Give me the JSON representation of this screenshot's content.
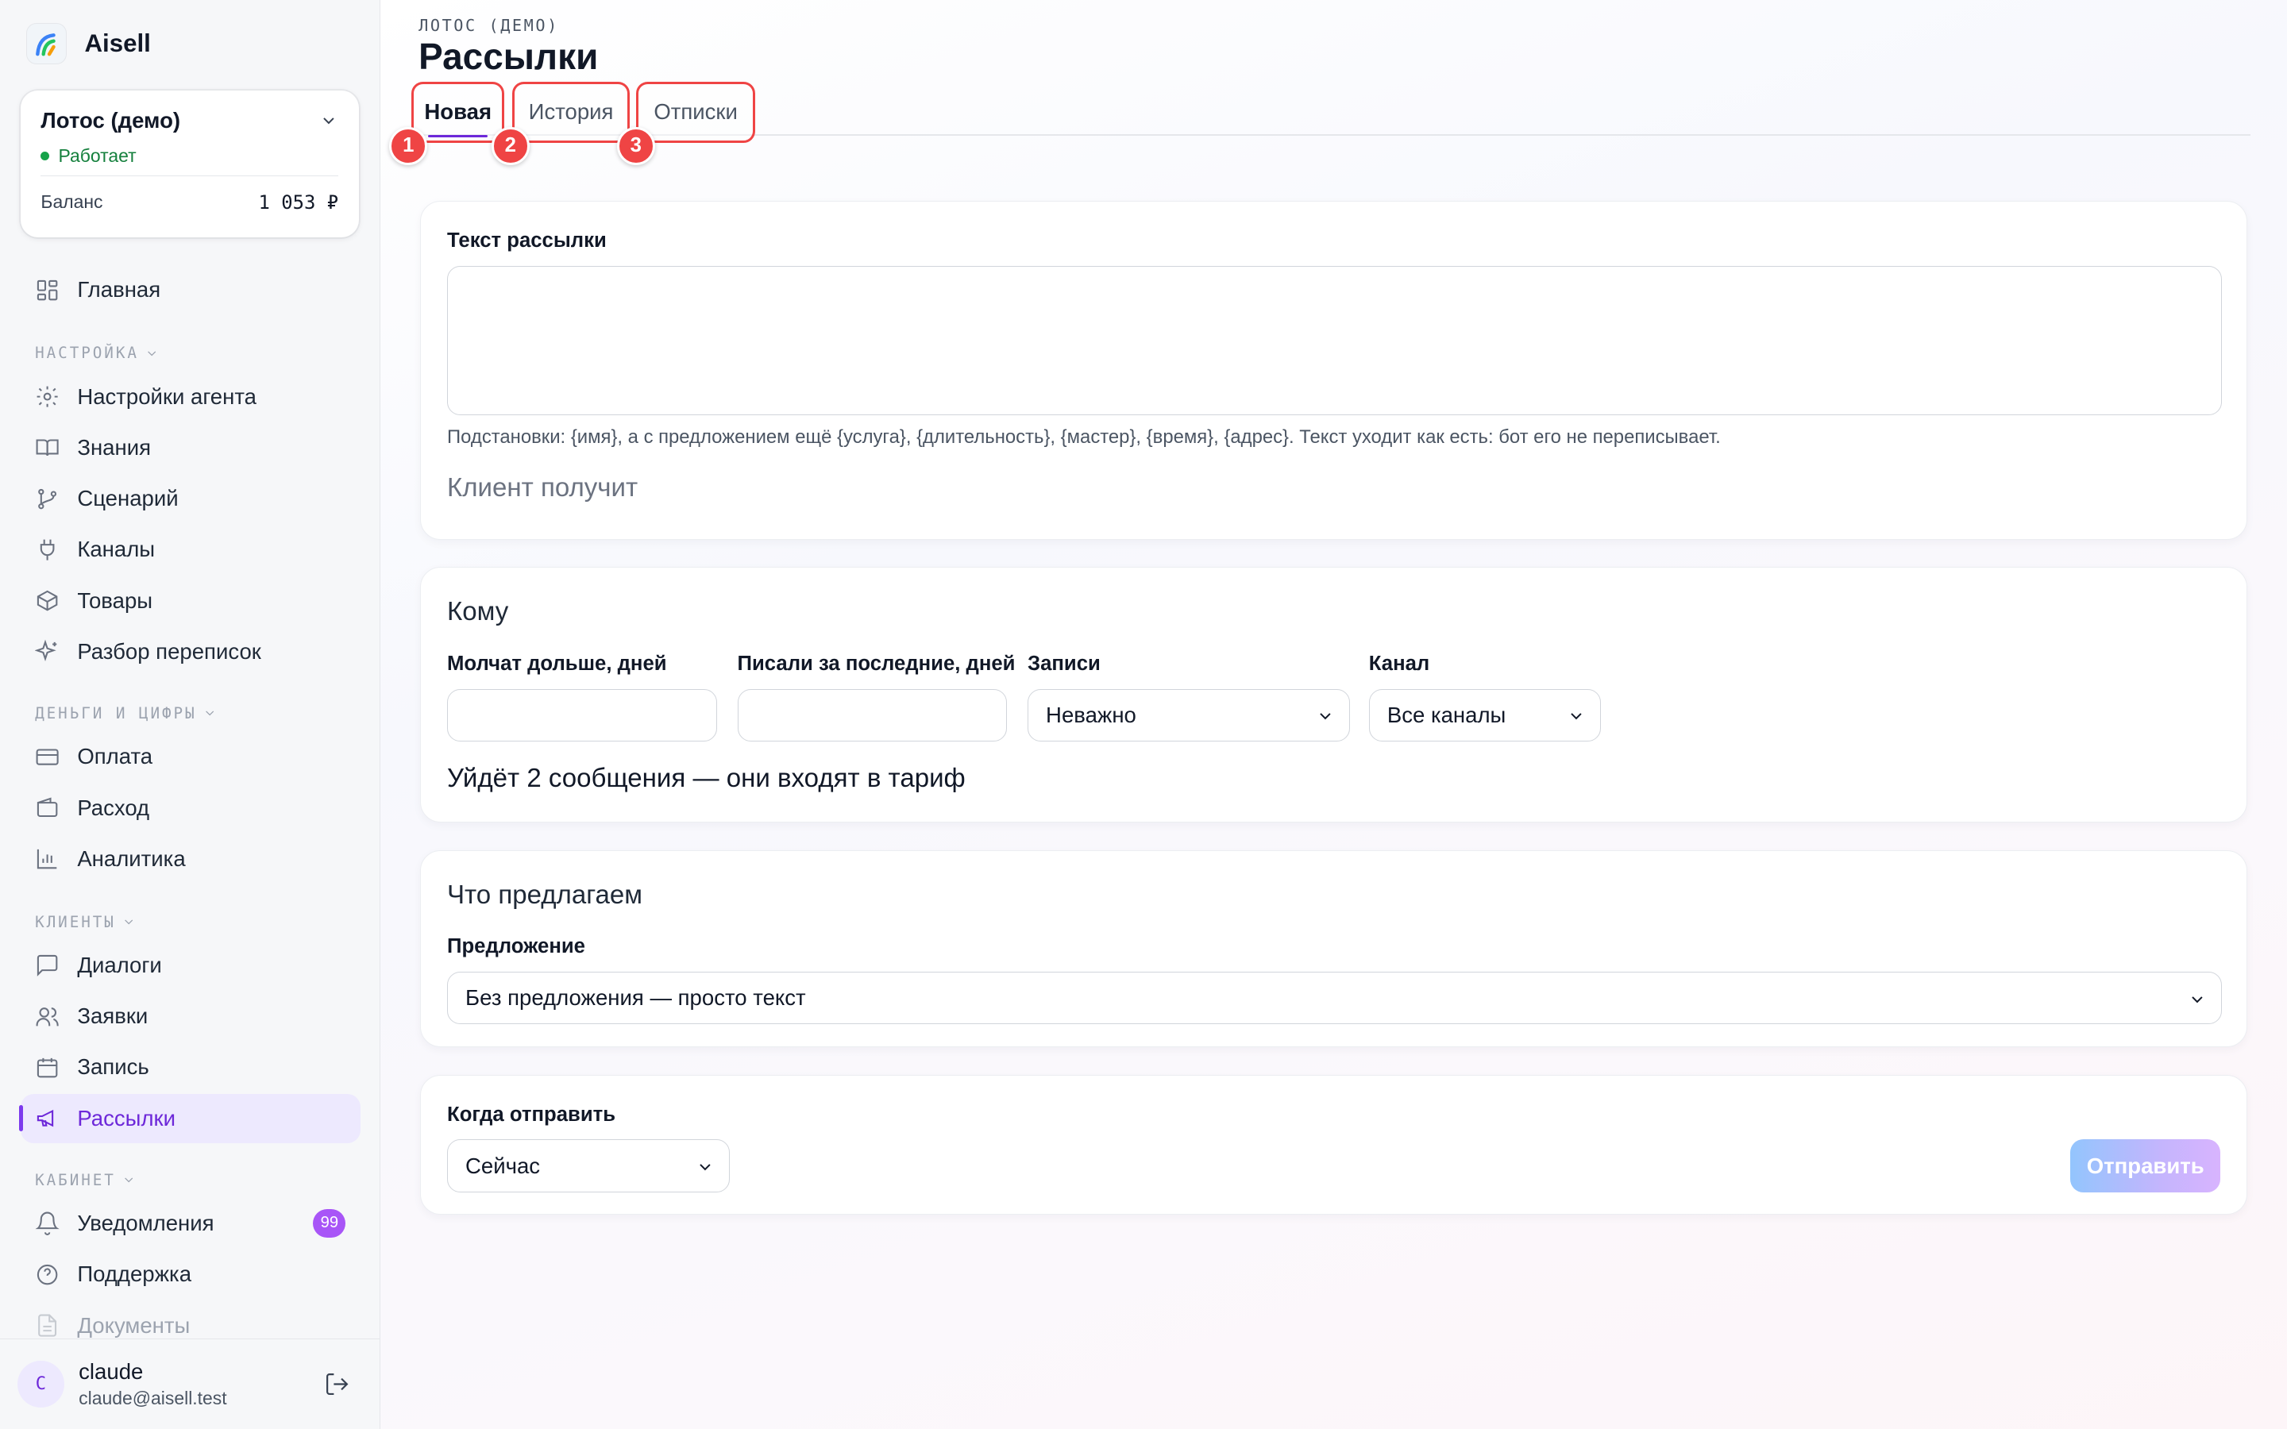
{
  "brand": {
    "name": "Aisell"
  },
  "org": {
    "name": "Лотос (демо)",
    "status": "Работает",
    "balance_label": "Баланс",
    "balance_value": "1 053 ₽"
  },
  "nav": {
    "home": "Главная",
    "settings_section": "НАСТРОЙКА",
    "agent_settings": "Настройки агента",
    "knowledge": "Знания",
    "scenario": "Сценарий",
    "channels": "Каналы",
    "products": "Товары",
    "chat_review": "Разбор переписок",
    "money_section": "ДЕНЬГИ И ЦИФРЫ",
    "payment": "Оплата",
    "expense": "Расход",
    "analytics": "Аналитика",
    "clients_section": "КЛИЕНТЫ",
    "dialogs": "Диалоги",
    "requests": "Заявки",
    "booking": "Запись",
    "mailings": "Рассылки",
    "cabinet_section": "КАБИНЕТ",
    "notifications": "Уведомления",
    "notifications_count": "99",
    "support": "Поддержка",
    "documents": "Документы"
  },
  "user": {
    "initial": "C",
    "name": "claude",
    "email": "claude@aisell.test"
  },
  "header": {
    "eyebrow": "ЛОТОС (ДЕМО)",
    "title": "Рассылки"
  },
  "tabs": [
    {
      "label": "Новая",
      "marker": "1"
    },
    {
      "label": "История",
      "marker": "2"
    },
    {
      "label": "Отписки",
      "marker": "3"
    }
  ],
  "message_card": {
    "label": "Текст рассылки",
    "hint": "Подстановки: {имя}, а с предложением ещё {услуга}, {длительность}, {мастер}, {время}, {адрес}. Текст уходит как есть: бот его не переписывает.",
    "preview_title": "Клиент получит"
  },
  "audience_card": {
    "title": "Кому",
    "silent_label": "Молчат дольше, дней",
    "recent_label": "Писали за последние, дней",
    "bookings_label": "Записи",
    "bookings_value": "Неважно",
    "channel_label": "Канал",
    "channel_value": "Все каналы",
    "summary": "Уйдёт 2 сообщения — они входят в тариф"
  },
  "offer_card": {
    "title": "Что предлагаем",
    "offer_label": "Предложение",
    "offer_value": "Без предложения — просто текст"
  },
  "schedule_card": {
    "when_label": "Когда отправить",
    "when_value": "Сейчас",
    "send_button": "Отправить"
  },
  "colors": {
    "accent": "#6d28d9",
    "status_green": "#16a34a",
    "marker_red": "#ef4444",
    "badge": "#a855f7"
  }
}
